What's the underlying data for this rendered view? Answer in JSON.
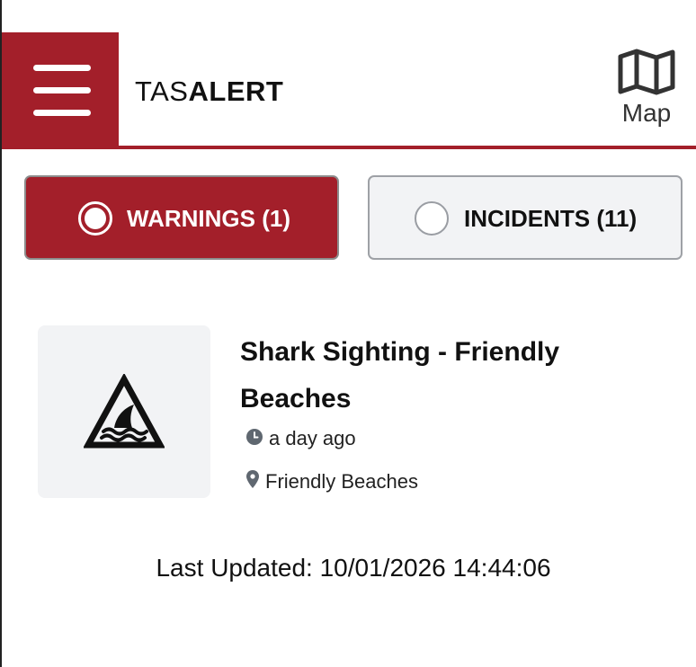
{
  "header": {
    "brand_light": "TAS",
    "brand_bold": "ALERT",
    "map_label": "Map",
    "accent_color": "#a31f2a"
  },
  "filters": {
    "warnings": {
      "label": "WARNINGS (1)",
      "selected": true
    },
    "incidents": {
      "label": "INCIDENTS (11)",
      "selected": false
    }
  },
  "alerts": [
    {
      "icon": "shark-warning-icon",
      "title": "Shark Sighting - Friendly Beaches",
      "time": "a day ago",
      "location": "Friendly Beaches"
    }
  ],
  "footer": {
    "last_updated": "Last Updated: 10/01/2026 14:44:06"
  }
}
